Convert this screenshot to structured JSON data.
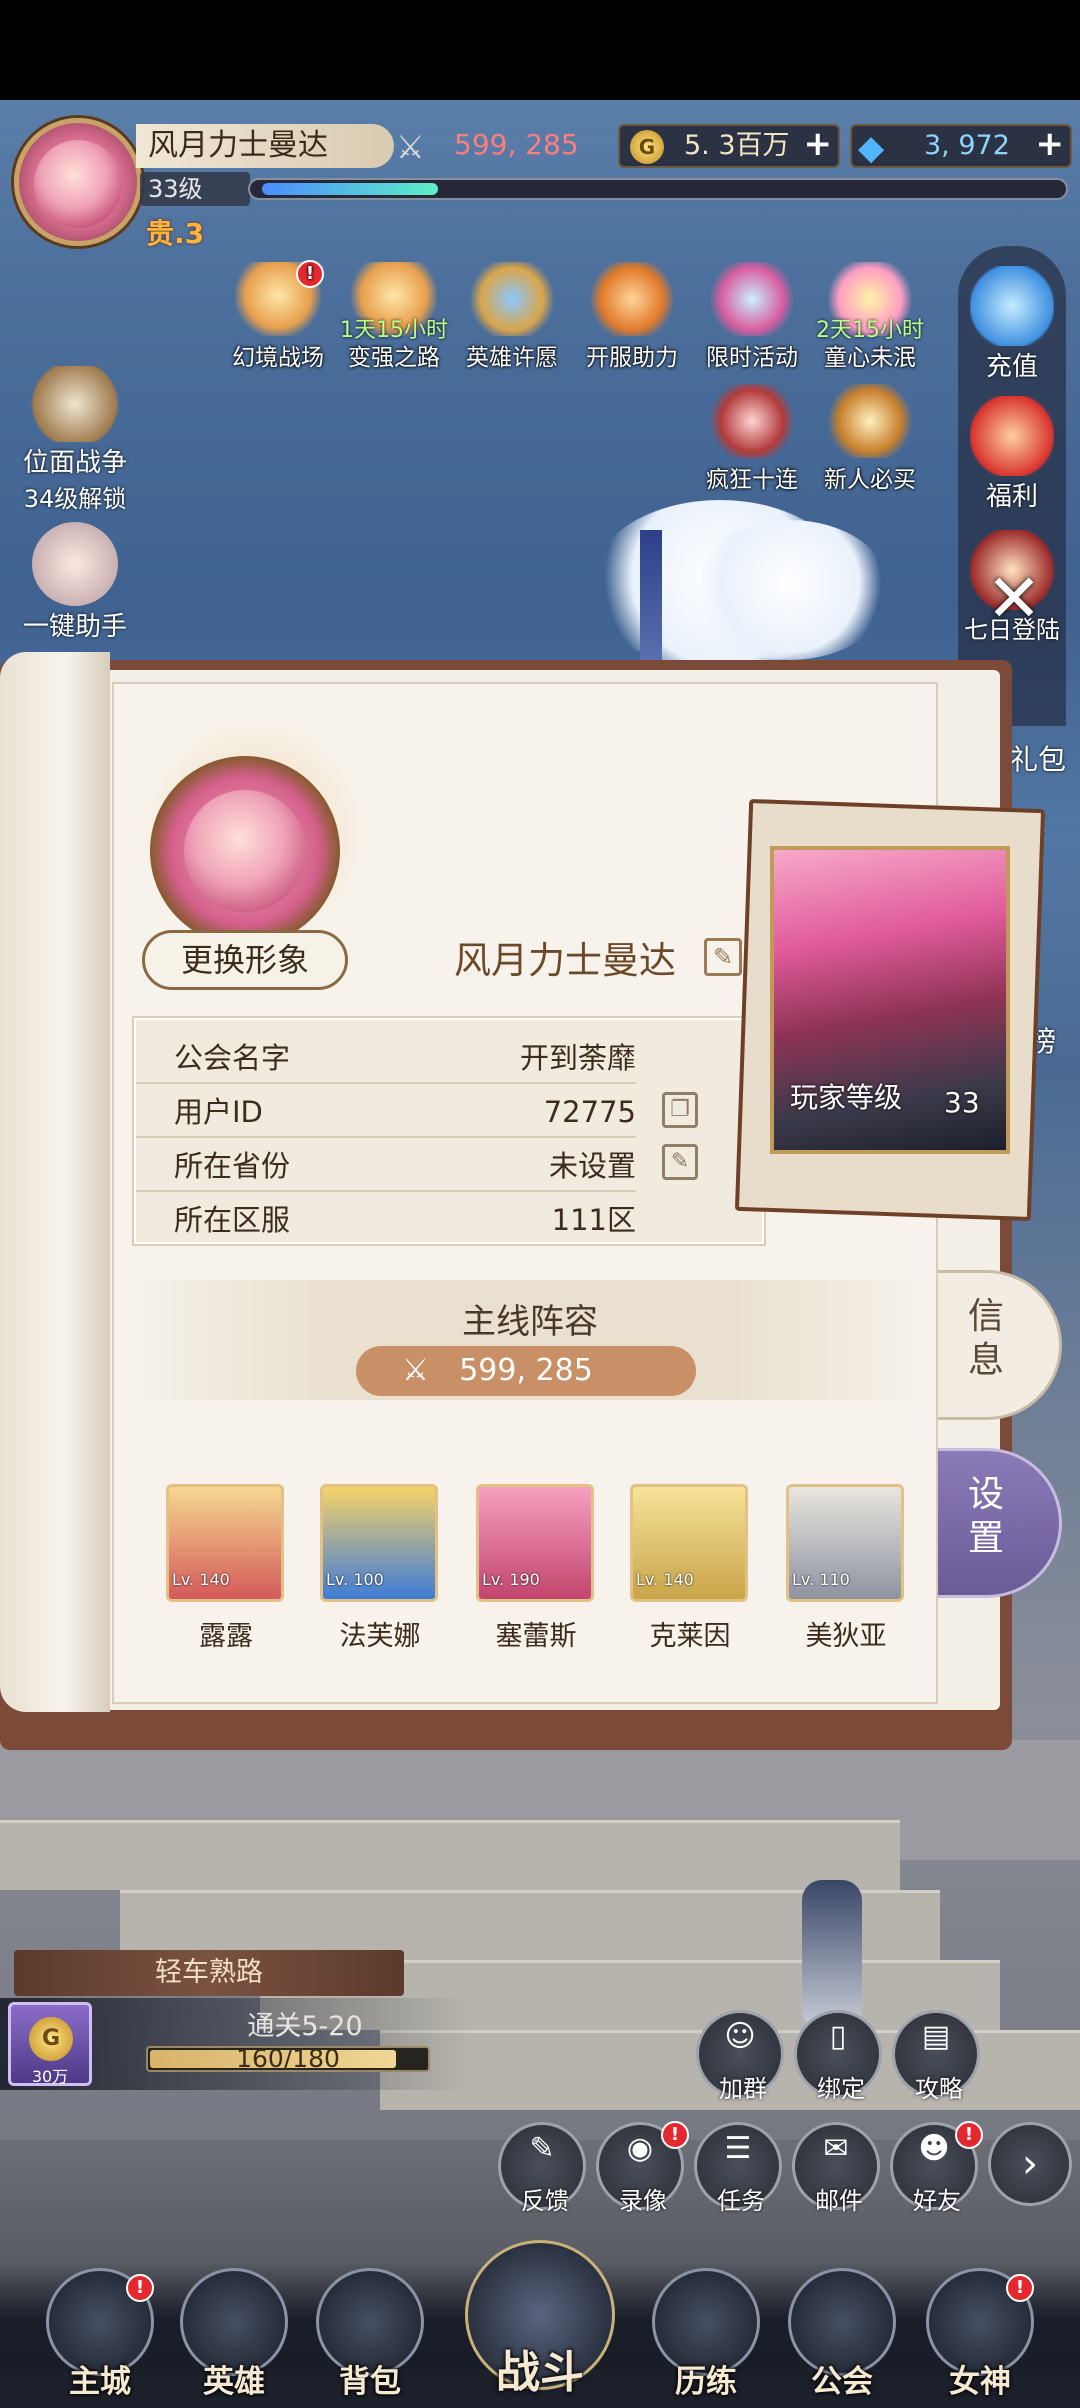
{
  "player": {
    "name": "风月力士曼达",
    "level": "33级",
    "vip": "贵.3",
    "level_progress": 0.22
  },
  "resources": {
    "power": "599, 285",
    "gold": "5. 3百万",
    "diamonds": "3, 972",
    "plus": "+"
  },
  "events": [
    {
      "label": "幻境战场",
      "timer": "",
      "badge": "!"
    },
    {
      "label": "变强之路",
      "timer": "1天15小时",
      "badge": ""
    },
    {
      "label": "英雄许愿",
      "timer": "",
      "badge": ""
    },
    {
      "label": "开服助力",
      "timer": "",
      "badge": ""
    },
    {
      "label": "限时活动",
      "timer": "",
      "badge": ""
    },
    {
      "label": "童心未泯",
      "timer": "2天15小时",
      "badge": ""
    },
    {
      "label": "疯狂十连",
      "timer": "",
      "badge": ""
    },
    {
      "label": "新人必买",
      "timer": "",
      "badge": ""
    }
  ],
  "left_side": [
    {
      "label": "位面战争",
      "sub": "34级解锁"
    },
    {
      "label": "一键助手",
      "sub": ""
    }
  ],
  "right_side": [
    {
      "label": "充值"
    },
    {
      "label": "福利"
    },
    {
      "label": "七日登陆"
    },
    {
      "label": "礼包"
    },
    {
      "label": "榜"
    }
  ],
  "profile": {
    "change_avatar": "更换形象",
    "name": "风月力士曼达",
    "rows": [
      {
        "key": "公会名字",
        "value": "开到荼靡"
      },
      {
        "key": "用户ID",
        "value": "72775"
      },
      {
        "key": "所在省份",
        "value": "未设置"
      },
      {
        "key": "所在区服",
        "value": "111区"
      }
    ],
    "card_label": "玩家等级",
    "card_level": "33"
  },
  "lineup": {
    "title": "主线阵容",
    "power": "599, 285",
    "heroes": [
      {
        "name": "露露",
        "level": "Lv. 140"
      },
      {
        "name": "法芙娜",
        "level": "Lv. 100"
      },
      {
        "name": "塞蕾斯",
        "level": "Lv. 190"
      },
      {
        "name": "克莱因",
        "level": "Lv. 140"
      },
      {
        "name": "美狄亚",
        "level": "Lv. 110"
      }
    ]
  },
  "tabs": {
    "info": "信息",
    "settings": "设置"
  },
  "stage": {
    "banner": "轻车熟路",
    "reward": "30万",
    "title": "通关5-20",
    "progress_text": "160/180",
    "progress": 0.89
  },
  "quick_buttons": [
    {
      "label": "加群",
      "icon": "qq-icon"
    },
    {
      "label": "绑定",
      "icon": "phone-icon"
    },
    {
      "label": "攻略",
      "icon": "book-icon"
    },
    {
      "label": "反馈",
      "icon": "feedback-icon"
    },
    {
      "label": "录像",
      "icon": "camera-icon"
    },
    {
      "label": "任务",
      "icon": "scroll-icon"
    },
    {
      "label": "邮件",
      "icon": "mail-icon"
    },
    {
      "label": "好友",
      "icon": "friends-icon"
    }
  ],
  "nav": [
    {
      "label": "主城"
    },
    {
      "label": "英雄"
    },
    {
      "label": "背包"
    },
    {
      "label": "战斗"
    },
    {
      "label": "历练"
    },
    {
      "label": "公会"
    },
    {
      "label": "女神"
    }
  ]
}
